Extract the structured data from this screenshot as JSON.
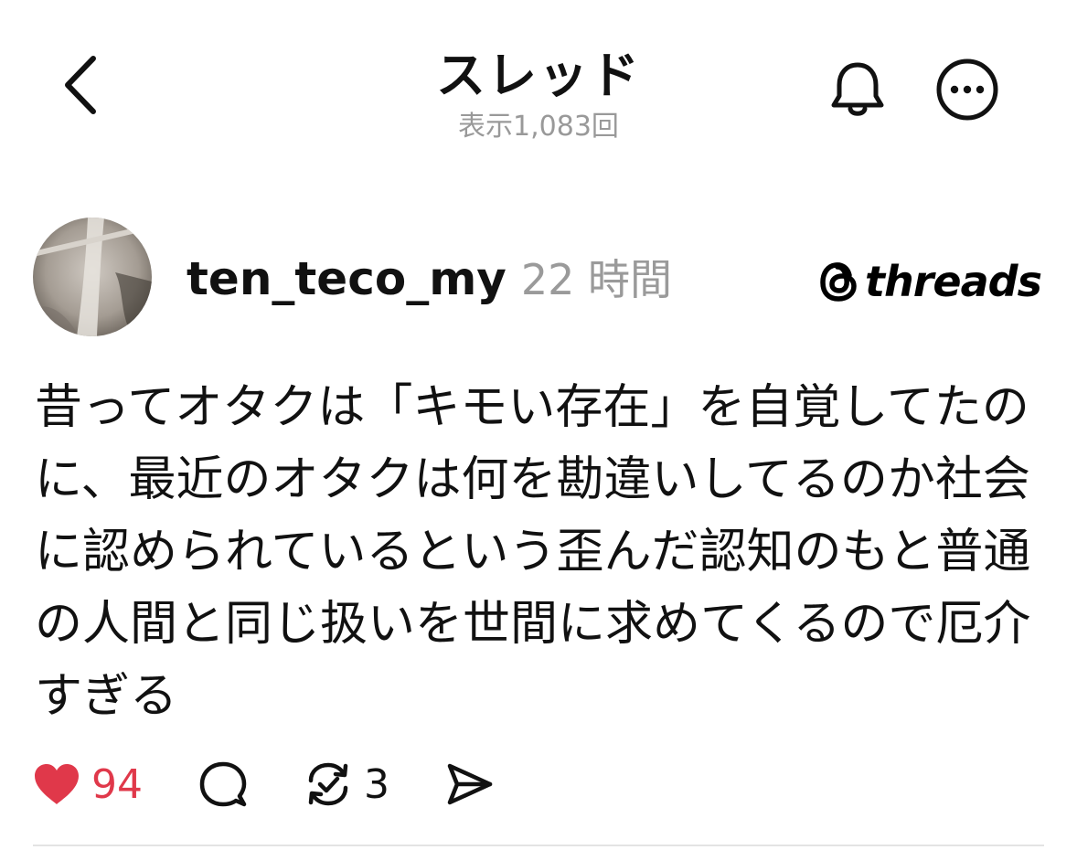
{
  "header": {
    "title": "スレッド",
    "views": "表示1,083回",
    "icons": {
      "back": "chevron-left-icon",
      "bell": "bell-icon",
      "more": "more-icon"
    }
  },
  "post": {
    "username": "ten_teco_my",
    "timestamp": "22 時間",
    "brand": "threads",
    "text": "昔ってオタクは「キモい存在」を自覚してたのに、最近のオタクは何を勘違いしてるのか社会に認められているという歪んだ認知のもと普通の人間と同じ扱いを世間に求めてくるので厄介すぎる",
    "actions": {
      "like_count": "94",
      "repost_count": "3"
    }
  },
  "colors": {
    "like_red": "#e0384a",
    "muted_gray": "#9a9a9a",
    "text": "#111111"
  }
}
